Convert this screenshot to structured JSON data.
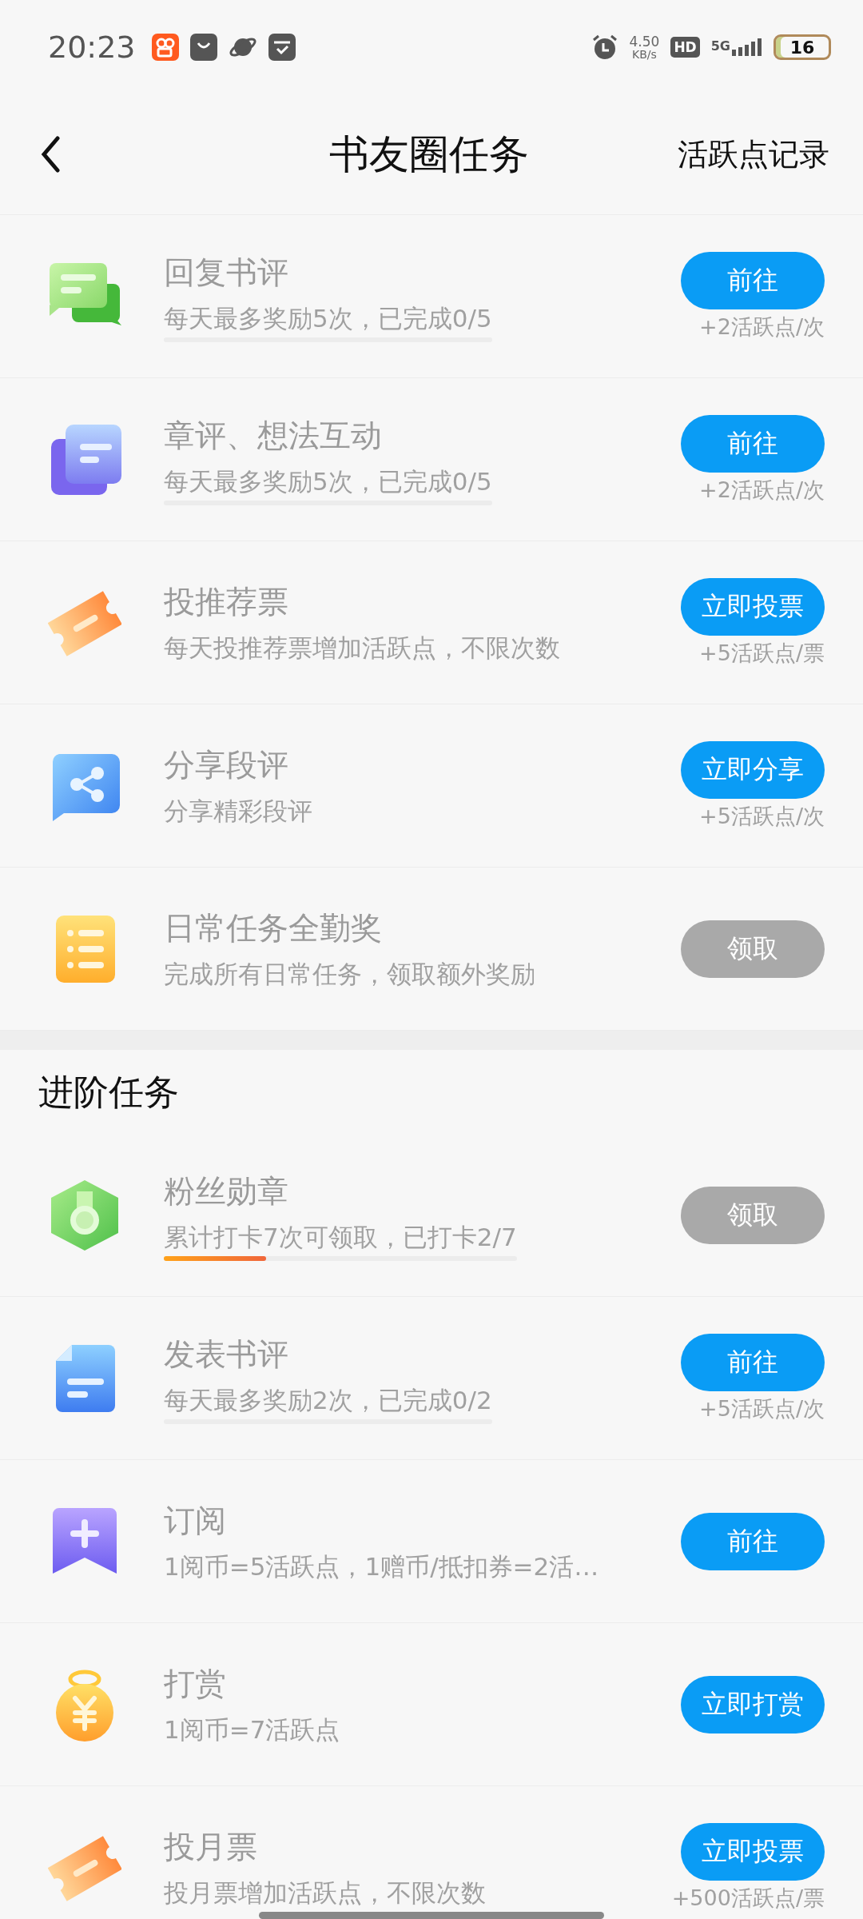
{
  "status_bar": {
    "time": "20:23",
    "speed": "4.50",
    "speed_unit": "KB/s",
    "hd": "HD",
    "network": "5G",
    "battery": "16"
  },
  "nav": {
    "title": "书友圈任务",
    "action": "活跃点记录"
  },
  "sections": [
    {
      "tasks": [
        {
          "kind": "chat",
          "title": "回复书评",
          "desc": "每天最多奖励5次，已完成0/5",
          "level": 0,
          "button": "前往",
          "disabled": false,
          "reward": "+2活跃点/次"
        },
        {
          "kind": "cards",
          "title": "章评、想法互动",
          "desc": "每天最多奖励5次，已完成0/5",
          "level": 0,
          "button": "前往",
          "disabled": false,
          "reward": "+2活跃点/次"
        },
        {
          "kind": "ticket",
          "title": "投推荐票",
          "desc": "每天投推荐票增加活跃点，不限次数",
          "button": "立即投票",
          "disabled": false,
          "reward": "+5活跃点/票"
        },
        {
          "kind": "share",
          "title": "分享段评",
          "desc": "分享精彩段评",
          "button": "立即分享",
          "disabled": false,
          "reward": "+5活跃点/次"
        },
        {
          "kind": "list",
          "title": "日常任务全勤奖",
          "desc": "完成所有日常任务，领取额外奖励",
          "button": "领取",
          "disabled": true
        }
      ]
    },
    {
      "title": "进阶任务",
      "tasks": [
        {
          "kind": "medal",
          "title": "粉丝勋章",
          "desc": "累计打卡7次可领取，已打卡2/7",
          "level": 0.29,
          "button": "领取",
          "disabled": true
        },
        {
          "kind": "doc",
          "title": "发表书评",
          "desc": "每天最多奖励2次，已完成0/2",
          "level": 0,
          "button": "前往",
          "disabled": false,
          "reward": "+5活跃点/次"
        },
        {
          "kind": "plus",
          "title": "订阅",
          "desc": "1阅币=5活跃点，1赠币/抵扣券=2活…",
          "button": "前往",
          "disabled": false
        },
        {
          "kind": "coin",
          "title": "打赏",
          "desc": "1阅币=7活跃点",
          "button": "立即打赏",
          "disabled": false
        },
        {
          "kind": "ticket",
          "title": "投月票",
          "desc": "投月票增加活跃点，不限次数",
          "button": "立即投票",
          "disabled": false,
          "reward": "+500活跃点/票"
        }
      ]
    }
  ]
}
